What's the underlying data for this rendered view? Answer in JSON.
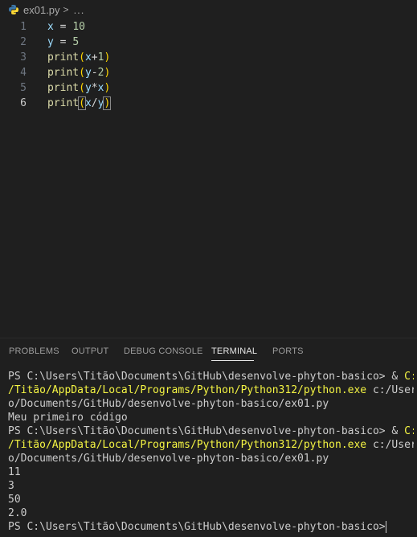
{
  "breadcrumb": {
    "file": "ex01.py",
    "separator": ">",
    "ellipsis": "..."
  },
  "editor": {
    "lines": [
      {
        "num": "1",
        "tokens": [
          [
            "x",
            "var"
          ],
          [
            " = ",
            "op"
          ],
          [
            "10",
            "num"
          ]
        ]
      },
      {
        "num": "2",
        "tokens": [
          [
            "y",
            "var"
          ],
          [
            " = ",
            "op"
          ],
          [
            "5",
            "num"
          ]
        ]
      },
      {
        "num": "3",
        "tokens": [
          [
            "print",
            "fn"
          ],
          [
            "(",
            "p1"
          ],
          [
            "x",
            "var"
          ],
          [
            "+",
            "op"
          ],
          [
            "1",
            "num"
          ],
          [
            ")",
            "p1"
          ]
        ]
      },
      {
        "num": "4",
        "tokens": [
          [
            "print",
            "fn"
          ],
          [
            "(",
            "p1"
          ],
          [
            "y",
            "var"
          ],
          [
            "-",
            "op"
          ],
          [
            "2",
            "num"
          ],
          [
            ")",
            "p1"
          ]
        ]
      },
      {
        "num": "5",
        "tokens": [
          [
            "print",
            "fn"
          ],
          [
            "(",
            "p1"
          ],
          [
            "y",
            "var"
          ],
          [
            "*",
            "op"
          ],
          [
            "x",
            "var"
          ],
          [
            ")",
            "p1"
          ]
        ]
      },
      {
        "num": "6",
        "tokens": [
          [
            "print",
            "fn"
          ],
          [
            "(",
            "p1m"
          ],
          [
            "x",
            "var"
          ],
          [
            "/",
            "op"
          ],
          [
            "y",
            "var"
          ],
          [
            ")",
            "p1m"
          ]
        ]
      }
    ],
    "active_line": "6"
  },
  "panel": {
    "tabs": [
      "PROBLEMS",
      "OUTPUT",
      "DEBUG CONSOLE",
      "TERMINAL",
      "PORTS"
    ],
    "active_tab": "TERMINAL"
  },
  "terminal": {
    "lines": [
      [
        [
          "PS C:\\Users\\Titão\\Documents\\GitHub\\desenvolve-phyton-basico> & ",
          ""
        ],
        [
          "C:/Users",
          "yellow"
        ]
      ],
      [
        [
          "/Titão/AppData/Local/Programs/Python/Python312/python.exe",
          "yellow"
        ],
        [
          " c:/Users/Titã",
          ""
        ]
      ],
      [
        [
          "o/Documents/GitHub/desenvolve-phyton-basico/ex01.py",
          ""
        ]
      ],
      [
        [
          "Meu primeiro código",
          ""
        ]
      ],
      [
        [
          "PS C:\\Users\\Titão\\Documents\\GitHub\\desenvolve-phyton-basico> & ",
          ""
        ],
        [
          "C:/Users",
          "yellow"
        ]
      ],
      [
        [
          "/Titão/AppData/Local/Programs/Python/Python312/python.exe",
          "yellow"
        ],
        [
          " c:/Users/Titã",
          ""
        ]
      ],
      [
        [
          "o/Documents/GitHub/desenvolve-phyton-basico/ex01.py",
          ""
        ]
      ],
      [
        [
          "11",
          ""
        ]
      ],
      [
        [
          "3",
          ""
        ]
      ],
      [
        [
          "50",
          ""
        ]
      ],
      [
        [
          "2.0",
          ""
        ]
      ],
      [
        [
          "PS C:\\Users\\Titão\\Documents\\GitHub\\desenvolve-phyton-basico>",
          ""
        ]
      ]
    ]
  },
  "colors": {
    "background": "#1f1f1f",
    "accent_yellow": "#f5f543",
    "text": "#cccccc"
  }
}
